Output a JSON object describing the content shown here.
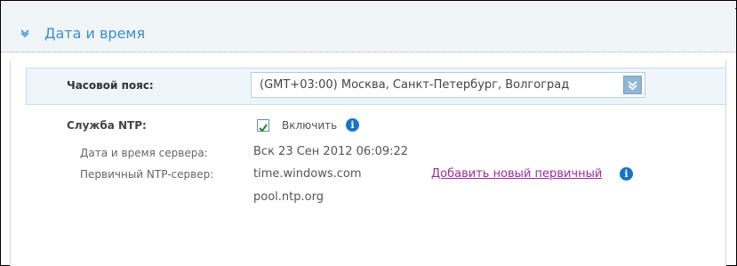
{
  "section": {
    "title": "Дата и время",
    "collapse_icon": "chevron-down-icon"
  },
  "timezone": {
    "label": "Часовой пояс:",
    "selected": "(GMT+03:00) Москва, Санкт-Петербург, Волгоград",
    "arrow_icon": "chevron-down-icon"
  },
  "ntp": {
    "label": "Служба NTP:",
    "enable_label": "Включить",
    "enabled": true,
    "info_icon": "info-icon",
    "server_time_label": "Дата и время сервера:",
    "server_time_value": "Вск 23 Сен 2012 06:09:22",
    "primary_label": "Первичный NTP-сервер:",
    "primary_servers": [
      "time.windows.com",
      "pool.ntp.org"
    ],
    "add_primary_link": "Добавить новый первичный"
  },
  "colors": {
    "accent": "#3a8fcd",
    "link": "#9a2d9a",
    "info": "#1773c8",
    "highlight_row": "#eef6fb"
  }
}
